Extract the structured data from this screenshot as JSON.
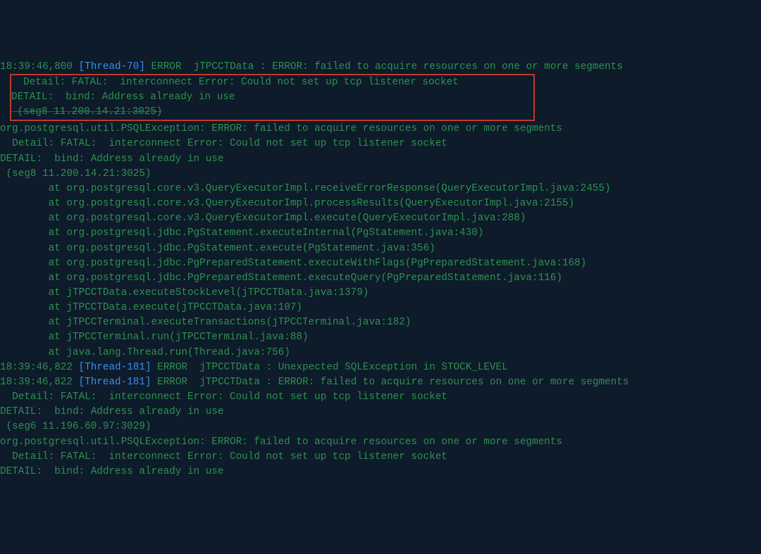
{
  "log": {
    "line1_time": "18:39:46,800",
    "line1_thread": "[Thread-70]",
    "line1_level": "ERROR",
    "line1_class": "jTPCCTData",
    "line1_msg": ": ERROR: failed to acquire resources on one or more segments",
    "box_line1": "  Detail: FATAL:  interconnect Error: Could not set up tcp listener socket",
    "box_line2": "DETAIL:  bind: Address already in use",
    "box_line3": " (seg8 11.200.14.21:3025)",
    "exc_line": "org.postgresql.util.PSQLException: ERROR: failed to acquire resources on one or more segments",
    "detail_line": "  Detail: FATAL:  interconnect Error: Could not set up tcp listener socket",
    "detail2_line": "DETAIL:  bind: Address already in use",
    "seg_line": " (seg8 11.200.14.21:3025)",
    "stack1": "        at org.postgresql.core.v3.QueryExecutorImpl.receiveErrorResponse(QueryExecutorImpl.java:2455)",
    "stack2": "        at org.postgresql.core.v3.QueryExecutorImpl.processResults(QueryExecutorImpl.java:2155)",
    "stack3": "        at org.postgresql.core.v3.QueryExecutorImpl.execute(QueryExecutorImpl.java:288)",
    "stack4": "        at org.postgresql.jdbc.PgStatement.executeInternal(PgStatement.java:430)",
    "stack5": "        at org.postgresql.jdbc.PgStatement.execute(PgStatement.java:356)",
    "stack6": "        at org.postgresql.jdbc.PgPreparedStatement.executeWithFlags(PgPreparedStatement.java:168)",
    "stack7": "        at org.postgresql.jdbc.PgPreparedStatement.executeQuery(PgPreparedStatement.java:116)",
    "stack8": "        at jTPCCTData.executeStockLevel(jTPCCTData.java:1379)",
    "stack9": "        at jTPCCTData.execute(jTPCCTData.java:107)",
    "stack10": "        at jTPCCTerminal.executeTransactions(jTPCCTerminal.java:182)",
    "stack11": "        at jTPCCTerminal.run(jTPCCTerminal.java:88)",
    "stack12": "        at java.lang.Thread.run(Thread.java:756)",
    "line2_time": "18:39:46,822",
    "line2_thread": "[Thread-181]",
    "line2_level": "ERROR",
    "line2_class": "jTPCCTData",
    "line2_msg": ": Unexpected SQLException in STOCK_LEVEL",
    "line3_time": "18:39:46,822",
    "line3_thread": "[Thread-181]",
    "line3_level": "ERROR",
    "line3_class": "jTPCCTData",
    "line3_msg": ": ERROR: failed to acquire resources on one or more segments",
    "blk2_detail": "  Detail: FATAL:  interconnect Error: Could not set up tcp listener socket",
    "blk2_detail2": "DETAIL:  bind: Address already in use",
    "blk2_seg": " (seg6 11.196.60.97:3029)",
    "blk2_exc": "org.postgresql.util.PSQLException: ERROR: failed to acquire resources on one or more segments",
    "blk2_detail3": "  Detail: FATAL:  interconnect Error: Could not set up tcp listener socket",
    "blk2_detail4": "DETAIL:  bind: Address already in use"
  }
}
